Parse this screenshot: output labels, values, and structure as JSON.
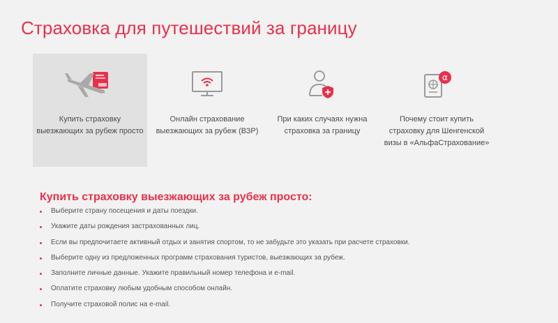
{
  "page": {
    "title": "Страховка для путешествий за границу"
  },
  "tiles": [
    {
      "label": "Купить страховку выезжающих за рубеж просто",
      "icon": "airplane-icon",
      "active": true
    },
    {
      "label": "Онлайн страхование выезжающих за рубеж (ВЗР)",
      "icon": "monitor-wifi-icon",
      "active": false
    },
    {
      "label": "При каких случаях нужна страховка за границу",
      "icon": "person-shield-icon",
      "active": false
    },
    {
      "label": "Почему стоит купить страховку для Шенгенской визы в «АльфаСтрахование»",
      "icon": "passport-icon",
      "active": false
    }
  ],
  "section": {
    "title": "Купить страховку выезжающих за рубеж просто:",
    "steps": [
      "Выберите страну посещения и даты поездки.",
      "Укажите даты рождения застрахованных лиц.",
      "Если вы предпочитаете активный отдых и занятия спортом, то не забудьте это указать при расчете страховки.",
      "Выберите одну из предложенных программ страхования туристов, выезжающих за рубеж.",
      "Заполните личные данные. Укажите правильный номер телефона и e-mail.",
      "Оплатите страховку любым удобным способом онлайн.",
      "Получите страховой полис на e-mail."
    ]
  },
  "colors": {
    "accent": "#e8304a",
    "active_tile": "#e1e1e1",
    "background": "#f2f2f2"
  }
}
